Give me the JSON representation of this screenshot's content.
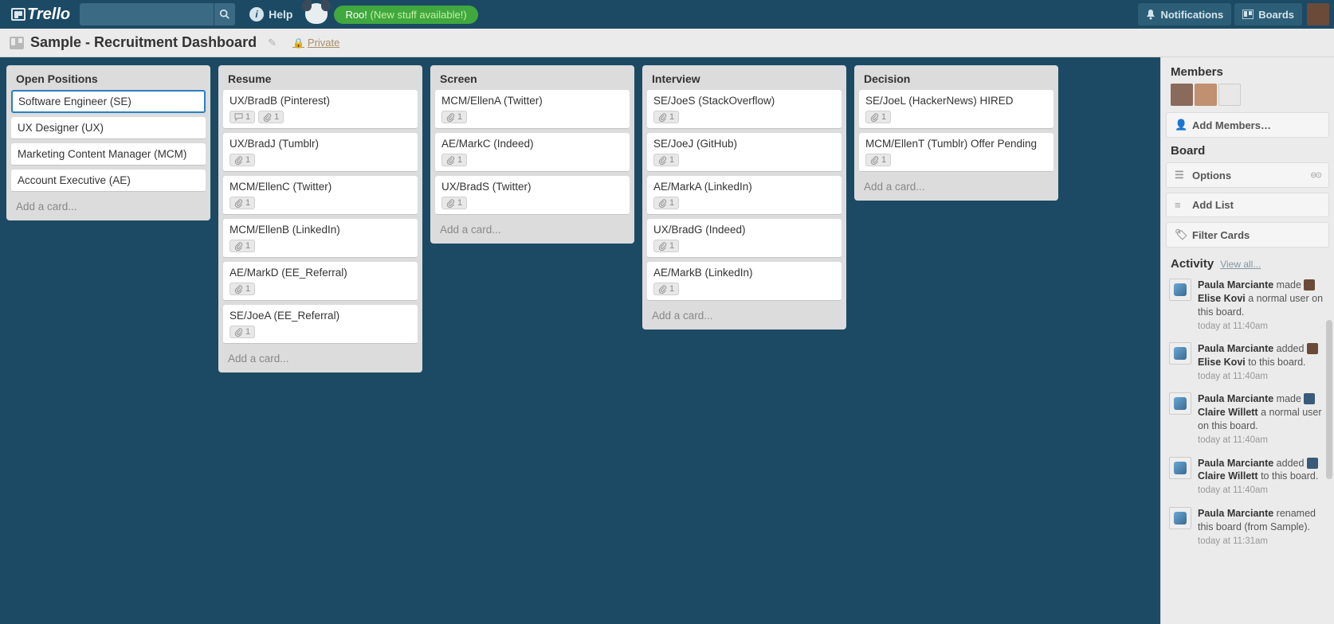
{
  "header": {
    "logo": "Trello",
    "help": "Help",
    "roo": "Roo! ",
    "roo_new": "(New stuff available!)",
    "notifications": "Notifications",
    "boards": "Boards"
  },
  "boardHeader": {
    "title": "Sample - Recruitment Dashboard",
    "private": "Private"
  },
  "lists": [
    {
      "title": "Open Positions",
      "cards": [
        {
          "title": "Software Engineer (SE)",
          "selected": true
        },
        {
          "title": "UX Designer (UX)"
        },
        {
          "title": "Marketing Content Manager (MCM)"
        },
        {
          "title": "Account Executive (AE)"
        }
      ]
    },
    {
      "title": "Resume",
      "cards": [
        {
          "title": "UX/BradB (Pinterest)",
          "comments": 1,
          "attach": 1
        },
        {
          "title": "UX/BradJ (Tumblr)",
          "attach": 1
        },
        {
          "title": "MCM/EllenC (Twitter)",
          "attach": 1
        },
        {
          "title": "MCM/EllenB (LinkedIn)",
          "attach": 1
        },
        {
          "title": "AE/MarkD (EE_Referral)",
          "attach": 1
        },
        {
          "title": "SE/JoeA (EE_Referral)",
          "attach": 1
        }
      ]
    },
    {
      "title": "Screen",
      "cards": [
        {
          "title": "MCM/EllenA (Twitter)",
          "attach": 1
        },
        {
          "title": "AE/MarkC (Indeed)",
          "attach": 1
        },
        {
          "title": "UX/BradS (Twitter)",
          "attach": 1
        }
      ]
    },
    {
      "title": "Interview",
      "cards": [
        {
          "title": "SE/JoeS (StackOverflow)",
          "attach": 1
        },
        {
          "title": "SE/JoeJ (GitHub)",
          "attach": 1
        },
        {
          "title": "AE/MarkA (LinkedIn)",
          "attach": 1
        },
        {
          "title": "UX/BradG (Indeed)",
          "attach": 1
        },
        {
          "title": "AE/MarkB (LinkedIn)",
          "attach": 1
        }
      ]
    },
    {
      "title": "Decision",
      "cards": [
        {
          "title": "SE/JoeL (HackerNews) HIRED",
          "attach": 1
        },
        {
          "title": "MCM/EllenT (Tumblr) Offer Pending",
          "attach": 1
        }
      ]
    }
  ],
  "addCard": "Add a card...",
  "sidebar": {
    "members": "Members",
    "addMembers": "Add Members…",
    "board": "Board",
    "options": "Options",
    "addList": "Add List",
    "filter": "Filter Cards",
    "activity": "Activity",
    "viewAll": "View all...",
    "items": [
      {
        "actor": "Paula Marciante",
        "verb": " made ",
        "target": "Elise Kovi",
        "rest": " a normal user on this board.",
        "time": "today at 11:40am",
        "av": 1
      },
      {
        "actor": "Paula Marciante",
        "verb": " added ",
        "target": "Elise Kovi",
        "rest": " to this board.",
        "time": "today at 11:40am",
        "av": 1
      },
      {
        "actor": "Paula Marciante",
        "verb": " made ",
        "target": "Claire Willett",
        "rest": " a normal user on this board.",
        "time": "today at 11:40am",
        "av": 2
      },
      {
        "actor": "Paula Marciante",
        "verb": " added ",
        "target": "Claire Willett",
        "rest": " to this board.",
        "time": "today at 11:40am",
        "av": 2
      },
      {
        "actor": "Paula Marciante",
        "verb": " renamed this board (from Sample).",
        "target": "",
        "rest": "",
        "time": "today at 11:31am",
        "av": 0
      }
    ]
  }
}
